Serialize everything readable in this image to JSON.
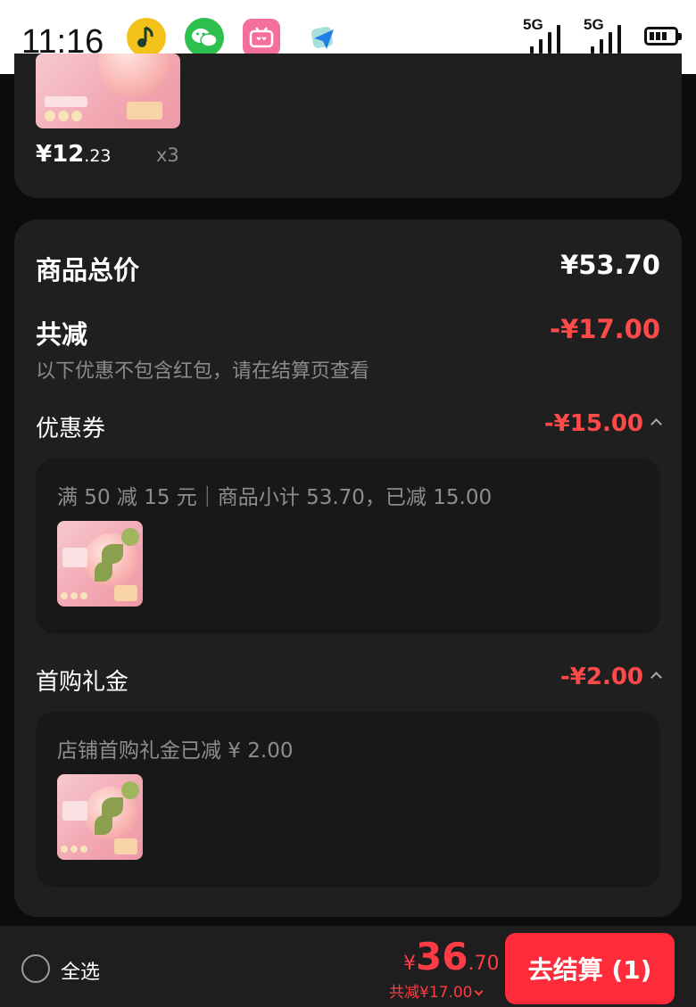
{
  "status_bar": {
    "time": "11:16",
    "apps": [
      "music-app-icon",
      "wechat-icon",
      "bilibili-icon",
      "send-app-icon"
    ],
    "signal_1": "5G",
    "signal_2": "5G"
  },
  "top_item": {
    "price_int": "¥12",
    "price_dec": ".23",
    "quantity": "x3"
  },
  "summary": {
    "total_label": "商品总价",
    "total_value": "¥53.70",
    "discount_label": "共减",
    "discount_value": "-¥17.00",
    "discount_note": "以下优惠不包含红包，请在结算页查看",
    "coupon": {
      "label": "优惠券",
      "value": "-¥15.00",
      "detail": "满 50 减 15 元｜商品小计 53.70，已减 15.00"
    },
    "first_purchase": {
      "label": "首购礼金",
      "value": "-¥2.00",
      "detail": "店铺首购礼金已减 ¥ 2.00"
    }
  },
  "bottom_bar": {
    "select_all": "全选",
    "total_yen": "¥",
    "total_int": "36",
    "total_dec": ".70",
    "discount_summary": "共减¥17.00",
    "checkout_label": "去结算 (1)"
  },
  "colors": {
    "accent_red": "#fe2c3a",
    "discount_red": "#ff4a4a",
    "card_bg": "#1f1f1f",
    "page_bg": "#0c0c0c"
  }
}
